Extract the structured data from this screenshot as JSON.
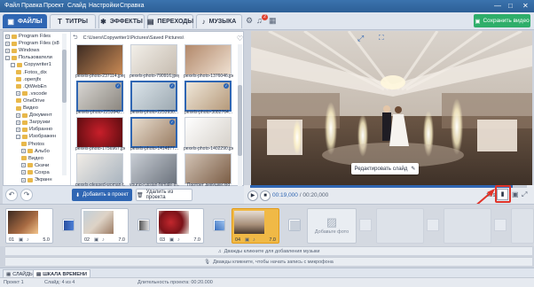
{
  "menu": {
    "items": [
      "Файл",
      "Правка",
      "Проект",
      "Слайд",
      "Настройки",
      "Справка"
    ],
    "window_controls": [
      "—",
      "□",
      "✕"
    ]
  },
  "tabs": [
    {
      "label": "ФАЙЛЫ",
      "icon": "folder-icon",
      "active": true
    },
    {
      "label": "ТИТРЫ",
      "icon": "text-icon",
      "active": false
    },
    {
      "label": "ЭФФЕКТЫ",
      "icon": "effects-icon",
      "active": false
    },
    {
      "label": "ПЕРЕХОДЫ",
      "icon": "transitions-icon",
      "active": false
    },
    {
      "label": "МУЗЫКА",
      "icon": "music-icon",
      "active": false
    }
  ],
  "toolbar": {
    "notifications_count": "2",
    "save_label": "Сохранить видео"
  },
  "tree": {
    "items": [
      {
        "label": "Program Files",
        "level": 1,
        "expander": "+"
      },
      {
        "label": "Program Files (x8",
        "level": 1,
        "expander": "+"
      },
      {
        "label": "Windows",
        "level": 1,
        "expander": "+"
      },
      {
        "label": "Пользователи",
        "level": 1,
        "expander": "-"
      },
      {
        "label": "Copywriter1",
        "level": 2,
        "expander": "-"
      },
      {
        "label": ".Fotos_dix",
        "level": 3,
        "expander": ""
      },
      {
        "label": ".openjfx",
        "level": 3,
        "expander": ""
      },
      {
        "label": ".QtWebEn",
        "level": 3,
        "expander": ""
      },
      {
        "label": ".vscode",
        "level": 3,
        "expander": "+"
      },
      {
        "label": "OneDrive",
        "level": 3,
        "expander": ""
      },
      {
        "label": "Видео",
        "level": 3,
        "expander": ""
      },
      {
        "label": "Документ",
        "level": 3,
        "expander": "+"
      },
      {
        "label": "Загрузки",
        "level": 3,
        "expander": "+"
      },
      {
        "label": "Избранно",
        "level": 3,
        "expander": "+"
      },
      {
        "label": "Изображен",
        "level": 3,
        "expander": "-"
      },
      {
        "label": "Photos",
        "level": 4,
        "expander": ""
      },
      {
        "label": "Альбо",
        "level": 4,
        "expander": "+"
      },
      {
        "label": "Видео",
        "level": 4,
        "expander": ""
      },
      {
        "label": "Скачи",
        "level": 4,
        "expander": "+"
      },
      {
        "label": "Сохра",
        "level": 4,
        "expander": "+"
      },
      {
        "label": "Экранн",
        "level": 4,
        "expander": "+"
      }
    ]
  },
  "files": {
    "path": "C:\\Users\\Copywriter1\\Pictures\\Saved Pictures\\",
    "items": [
      {
        "name": "pexels-photo-237114.jpeg",
        "selected": false
      },
      {
        "name": "pexels-photo-790916.jpeg",
        "selected": false
      },
      {
        "name": "pexels-photo-1376046.jpeg",
        "selected": false
      },
      {
        "name": "pexels-photo-2253842...",
        "selected": true
      },
      {
        "name": "pexels-photo-2253930...",
        "selected": true
      },
      {
        "name": "pexels-photo-3082764...",
        "selected": true
      },
      {
        "name": "pexels-photo-1756967.jpeg",
        "selected": false
      },
      {
        "name": "pexels-photo-1414877...",
        "selected": true
      },
      {
        "name": "pexels-photo-1402290.jpeg",
        "selected": false
      },
      {
        "name": "pexels-pleased-woman-t...",
        "selected": false
      },
      {
        "name": "young-russian-female-in...",
        "selected": false
      },
      {
        "name": "Портрет девушки.jpg",
        "selected": false
      }
    ]
  },
  "actions": {
    "add_label": "Добавить в проект",
    "delete_label": "Удалить из проекта"
  },
  "preview": {
    "edit_label": "Редактировать слайд"
  },
  "player": {
    "time_current": "00:19,000",
    "time_total": "/ 00:20,000",
    "aspect_ratio": "16:9",
    "progress": 0.95
  },
  "timeline": {
    "slides": [
      {
        "number": "01",
        "duration": "5.0"
      },
      {
        "number": "02",
        "duration": "7.0"
      },
      {
        "number": "03",
        "duration": "7.0"
      },
      {
        "number": "04",
        "duration": "7.0"
      }
    ],
    "add_photo_label": "Добавьте фото",
    "music_hint": "Дважды кликните для добавления музыки",
    "mic_hint": "Дважды кликните, чтобы начать запись с микрофона"
  },
  "bottom_tabs": [
    {
      "label": "СЛАЙДЫ",
      "active": false
    },
    {
      "label": "ШКАЛА ВРЕМЕНИ",
      "active": true
    }
  ],
  "status": {
    "project": "Проект 1",
    "slide": "Слайд: 4 из 4",
    "duration": "Длительность проекта: 00:20.000"
  }
}
